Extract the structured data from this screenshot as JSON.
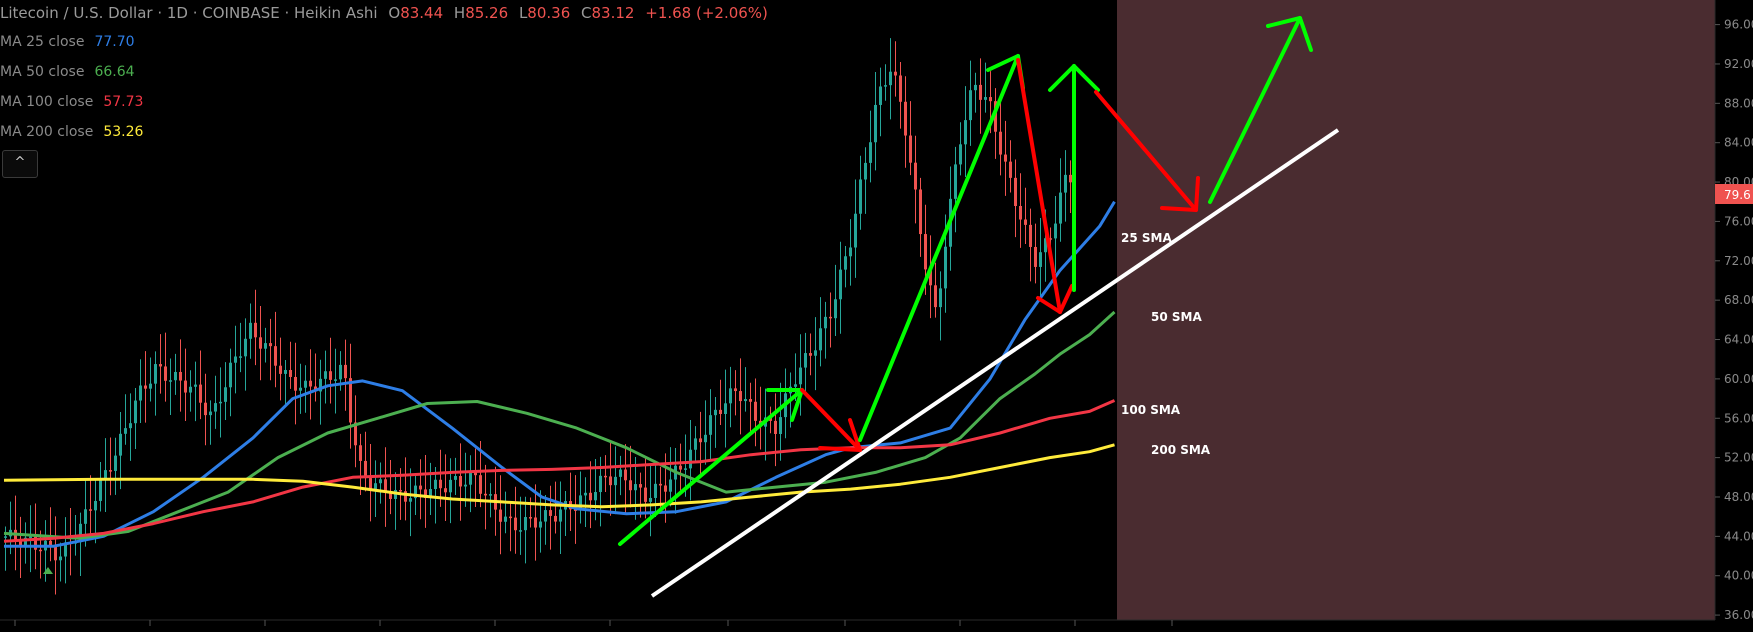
{
  "header": {
    "title": "Litecoin / U.S. Dollar · 1D · COINBASE · Heikin Ashi",
    "ohlc": [
      {
        "key": "O",
        "value": "83.44"
      },
      {
        "key": "H",
        "value": "85.26"
      },
      {
        "key": "L",
        "value": "80.36"
      },
      {
        "key": "C",
        "value": "83.12"
      }
    ],
    "change": "+1.68 (+2.06%)"
  },
  "moving_averages": [
    {
      "label": "MA 25 close",
      "value": "77.70",
      "color": "#2e7ee6"
    },
    {
      "label": "MA 50 close",
      "value": "66.64",
      "color": "#4caf50"
    },
    {
      "label": "MA 100 close",
      "value": "57.73",
      "color": "#f23645"
    },
    {
      "label": "MA 200 close",
      "value": "53.26",
      "color": "#ffeb3b"
    }
  ],
  "collapse_button": "^",
  "price_tag": {
    "value": "79.6",
    "color": "#ef5350"
  },
  "annotations": [
    "25 SMA",
    "50 SMA",
    "100 SMA",
    "200 SMA"
  ],
  "colors": {
    "up": "#26a69a",
    "down": "#ef5350",
    "highlight": "#4a2c30",
    "trend": "#ffffff",
    "arrow_up": "#00ff00",
    "arrow_down": "#ff0000"
  },
  "chart_data": {
    "type": "line",
    "candle_style": "heikin-ashi",
    "y_ticks": [
      "36.00",
      "40.00",
      "44.00",
      "48.00",
      "52.00",
      "56.00",
      "60.00",
      "64.00",
      "68.00",
      "72.00",
      "76.00",
      "80.00",
      "84.00",
      "88.00",
      "92.00",
      "96.00"
    ],
    "ylim": [
      35.5,
      98.5
    ],
    "x_bars": 230,
    "series": [
      {
        "name": "MA 25 close",
        "color": "#2e7ee6",
        "points": [
          [
            0,
            43.0
          ],
          [
            10,
            43.0
          ],
          [
            20,
            44.0
          ],
          [
            30,
            46.5
          ],
          [
            40,
            50.0
          ],
          [
            50,
            54.0
          ],
          [
            58,
            58.0
          ],
          [
            65,
            59.3
          ],
          [
            72,
            59.8
          ],
          [
            80,
            58.8
          ],
          [
            90,
            55.0
          ],
          [
            100,
            51.0
          ],
          [
            108,
            48.0
          ],
          [
            115,
            46.8
          ],
          [
            125,
            46.3
          ],
          [
            135,
            46.5
          ],
          [
            145,
            47.5
          ],
          [
            155,
            50.0
          ],
          [
            165,
            52.3
          ],
          [
            170,
            53.0
          ],
          [
            180,
            53.5
          ],
          [
            190,
            55.0
          ],
          [
            198,
            60.0
          ],
          [
            205,
            66.0
          ],
          [
            212,
            71.0
          ],
          [
            220,
            75.5
          ],
          [
            223,
            78.0
          ]
        ]
      },
      {
        "name": "MA 50 close",
        "color": "#4caf50",
        "points": [
          [
            0,
            44.3
          ],
          [
            15,
            43.8
          ],
          [
            25,
            44.5
          ],
          [
            35,
            46.5
          ],
          [
            45,
            48.5
          ],
          [
            55,
            52.0
          ],
          [
            65,
            54.5
          ],
          [
            75,
            56.0
          ],
          [
            85,
            57.5
          ],
          [
            95,
            57.7
          ],
          [
            105,
            56.5
          ],
          [
            115,
            55.0
          ],
          [
            125,
            53.0
          ],
          [
            135,
            50.5
          ],
          [
            145,
            48.5
          ],
          [
            155,
            49.0
          ],
          [
            165,
            49.5
          ],
          [
            175,
            50.5
          ],
          [
            185,
            52.0
          ],
          [
            192,
            54.0
          ],
          [
            200,
            58.0
          ],
          [
            207,
            60.5
          ],
          [
            212,
            62.5
          ],
          [
            218,
            64.5
          ],
          [
            223,
            66.8
          ]
        ]
      },
      {
        "name": "MA 100 close",
        "color": "#f23645",
        "points": [
          [
            0,
            43.5
          ],
          [
            10,
            43.8
          ],
          [
            20,
            44.3
          ],
          [
            30,
            45.3
          ],
          [
            40,
            46.5
          ],
          [
            50,
            47.5
          ],
          [
            60,
            49.0
          ],
          [
            70,
            50.0
          ],
          [
            80,
            50.2
          ],
          [
            90,
            50.5
          ],
          [
            100,
            50.7
          ],
          [
            110,
            50.8
          ],
          [
            120,
            51.0
          ],
          [
            130,
            51.3
          ],
          [
            140,
            51.6
          ],
          [
            150,
            52.3
          ],
          [
            160,
            52.8
          ],
          [
            170,
            53.0
          ],
          [
            180,
            53.0
          ],
          [
            190,
            53.3
          ],
          [
            200,
            54.5
          ],
          [
            210,
            56.0
          ],
          [
            218,
            56.7
          ],
          [
            223,
            57.8
          ]
        ]
      },
      {
        "name": "MA 200 close",
        "color": "#ffeb3b",
        "points": [
          [
            0,
            49.7
          ],
          [
            20,
            49.8
          ],
          [
            40,
            49.8
          ],
          [
            50,
            49.8
          ],
          [
            60,
            49.6
          ],
          [
            70,
            49.0
          ],
          [
            80,
            48.3
          ],
          [
            90,
            47.8
          ],
          [
            100,
            47.5
          ],
          [
            110,
            47.2
          ],
          [
            120,
            47.0
          ],
          [
            130,
            47.2
          ],
          [
            140,
            47.5
          ],
          [
            150,
            48.0
          ],
          [
            160,
            48.5
          ],
          [
            170,
            48.8
          ],
          [
            180,
            49.3
          ],
          [
            190,
            50.0
          ],
          [
            200,
            51.0
          ],
          [
            210,
            52.0
          ],
          [
            218,
            52.6
          ],
          [
            223,
            53.3
          ]
        ]
      }
    ]
  }
}
